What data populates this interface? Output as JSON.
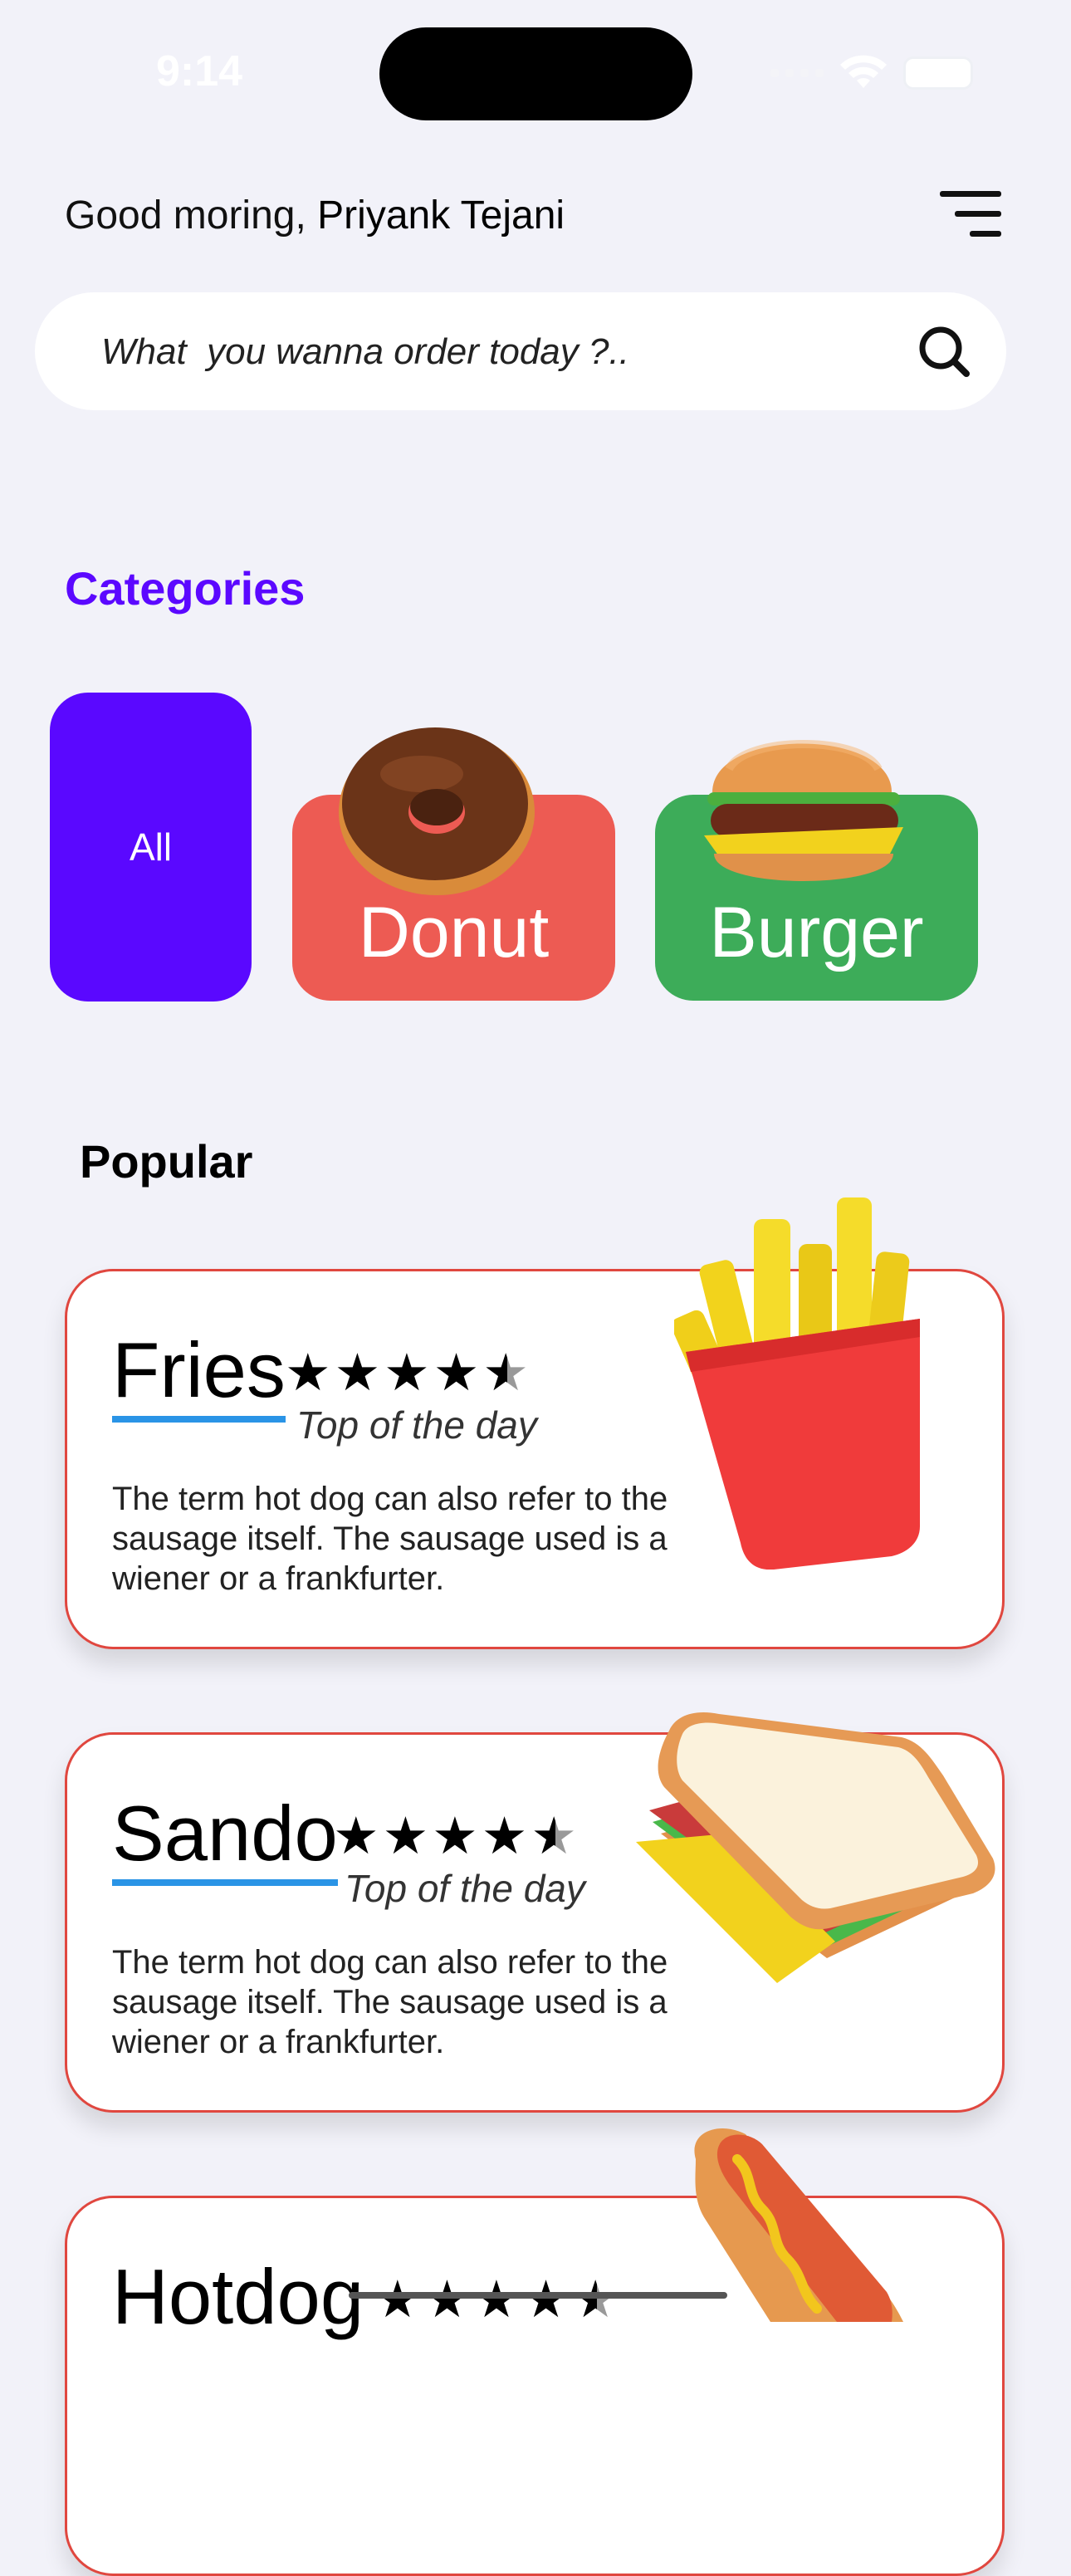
{
  "status": {
    "time": "9:14"
  },
  "header": {
    "greeting_prefix": "Good moring, ",
    "user_name": "Priyank Tejani"
  },
  "search": {
    "placeholder": "What  you wanna order today ?.."
  },
  "categories": {
    "title": "Categories",
    "items": [
      {
        "label": "All",
        "color": "#5a08ff"
      },
      {
        "label": "Donut",
        "color": "#ed5b53",
        "icon": "donut-icon"
      },
      {
        "label": "Burger",
        "color": "#3dac59",
        "icon": "burger-icon"
      }
    ]
  },
  "popular": {
    "title": "Popular",
    "items": [
      {
        "name": "Fries",
        "rating": 4.5,
        "stars": "★★★★",
        "tag": "Top of the day",
        "description": "The term hot dog can also refer to the sausage itself. The sausage used is a wiener or a frankfurter.",
        "icon": "fries-icon"
      },
      {
        "name": "Sando",
        "rating": 4.5,
        "stars": "★★★★",
        "tag": "Top of the day",
        "description": "The term hot dog can also refer to the sausage itself. The sausage used is a wiener or a frankfurter.",
        "icon": "sandwich-icon"
      },
      {
        "name": "Hotdog",
        "rating": 4.5,
        "stars": "★★★★",
        "icon": "hotdog-icon"
      }
    ]
  },
  "colors": {
    "accent": "#5b08ff",
    "card_border": "#e0473f",
    "underline": "#2a94e6"
  }
}
